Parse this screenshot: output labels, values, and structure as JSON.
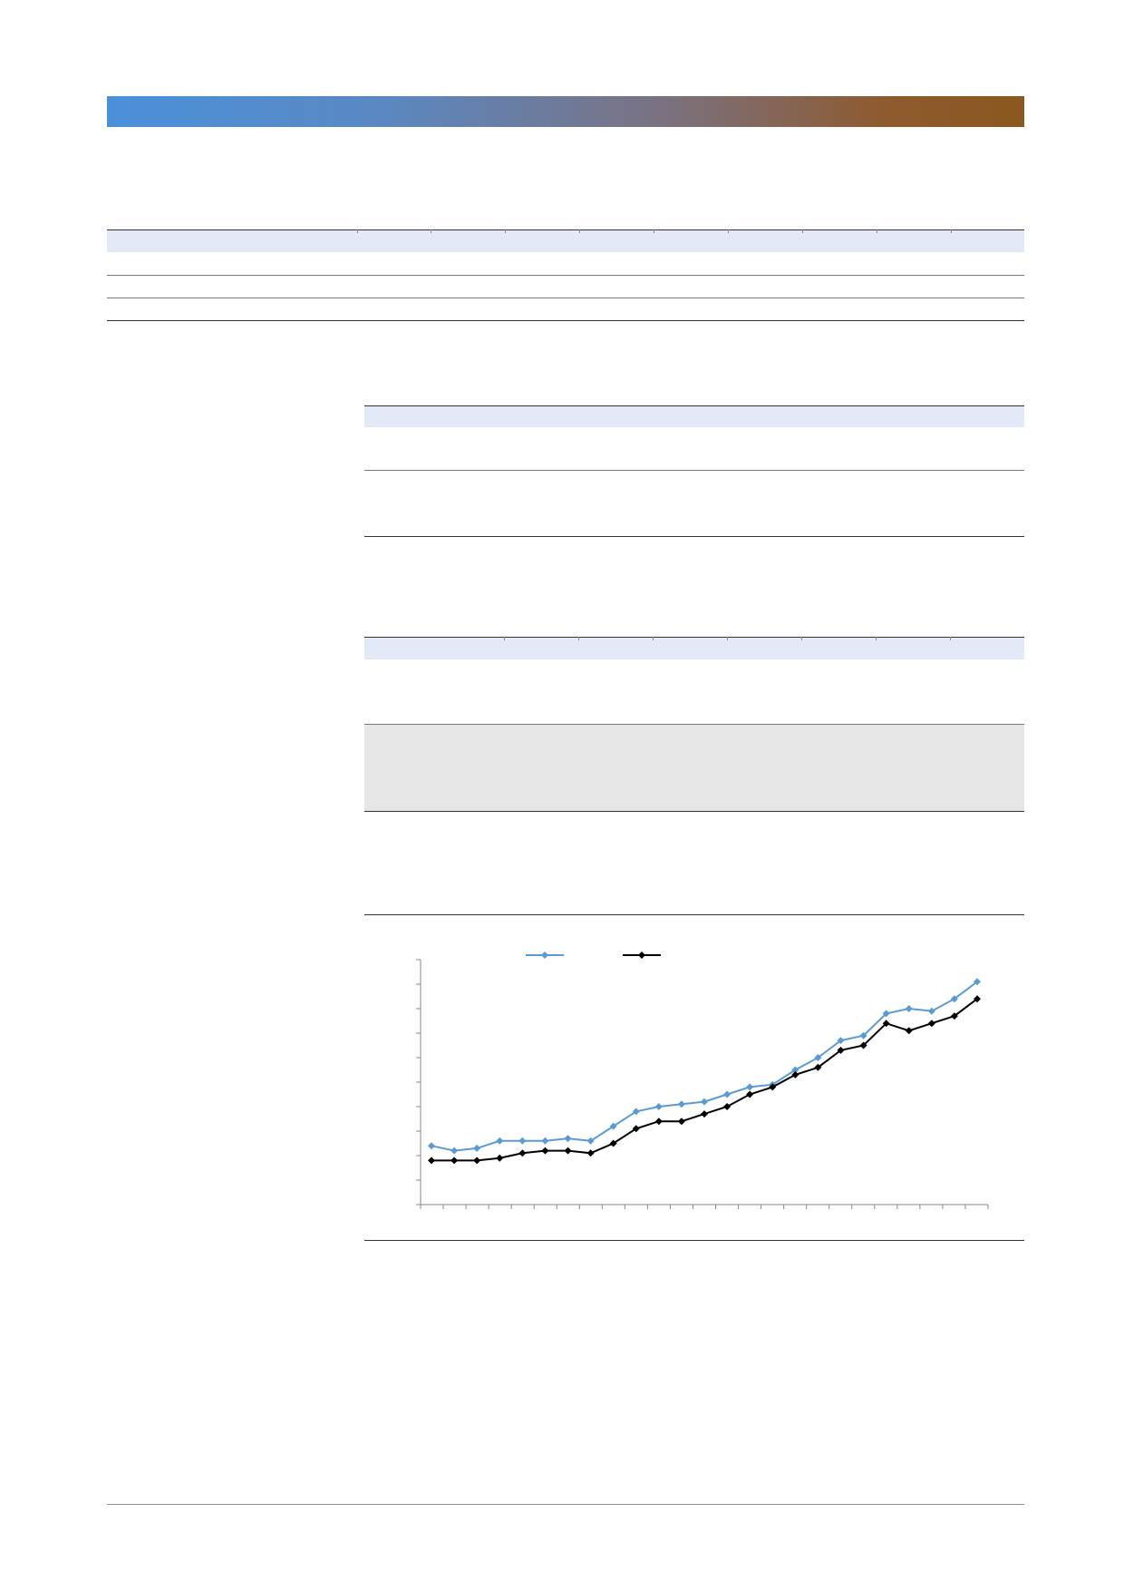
{
  "header": {
    "banner_colors": [
      "#4a90d9",
      "#8b581f"
    ]
  },
  "tables": [
    {
      "id": "table-1",
      "rows": 3,
      "columns": 10
    },
    {
      "id": "table-2",
      "rows": 2,
      "columns": 1
    },
    {
      "id": "table-3",
      "rows": 3,
      "columns": 9
    }
  ],
  "chart_data": {
    "type": "line",
    "title": "",
    "xlabel": "",
    "ylabel": "",
    "x": [
      1,
      2,
      3,
      4,
      5,
      6,
      7,
      8,
      9,
      10,
      11,
      12,
      13,
      14,
      15,
      16,
      17,
      18,
      19,
      20,
      21,
      22,
      23,
      24,
      25
    ],
    "ylim": [
      0,
      10
    ],
    "grid": false,
    "legend": "top-center",
    "series": [
      {
        "color": "#5b9bd5",
        "marker": "diamond",
        "values": [
          2.4,
          2.2,
          2.3,
          2.6,
          2.6,
          2.6,
          2.7,
          2.6,
          3.2,
          3.8,
          4.0,
          4.1,
          4.2,
          4.5,
          4.8,
          4.9,
          5.5,
          6.0,
          6.7,
          6.9,
          7.8,
          8.0,
          7.9,
          8.4,
          9.1
        ]
      },
      {
        "color": "#000000",
        "marker": "diamond",
        "values": [
          1.8,
          1.8,
          1.8,
          1.9,
          2.1,
          2.2,
          2.2,
          2.1,
          2.5,
          3.1,
          3.4,
          3.4,
          3.7,
          4.0,
          4.5,
          4.8,
          5.3,
          5.6,
          6.3,
          6.5,
          7.4,
          7.1,
          7.4,
          7.7,
          8.4
        ]
      }
    ]
  }
}
